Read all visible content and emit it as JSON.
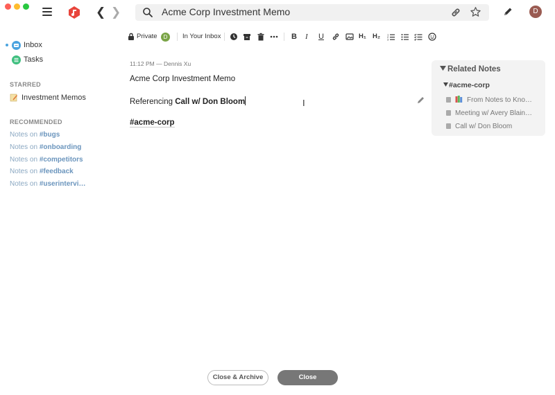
{
  "window": {
    "search_value": "Acme Corp Investment Memo",
    "user_initial": "D",
    "icons": [
      "menu-icon",
      "app-logo-icon",
      "back-icon",
      "forward-icon",
      "search-icon",
      "link-icon",
      "star-icon",
      "compose-icon"
    ]
  },
  "toolbar": {
    "privacy_label": "Private",
    "owner_initial": "D",
    "location_label": "In Your Inbox",
    "format_labels": {
      "bold": "B",
      "italic": "I",
      "underline": "U",
      "h1": "H₁",
      "h2": "H₂"
    }
  },
  "sidebar": {
    "items": [
      {
        "label": "Inbox",
        "icon": "inbox-icon",
        "color": "#4aa3df"
      },
      {
        "label": "Tasks",
        "icon": "tasks-icon",
        "color": "#3fbf7f"
      }
    ],
    "starred_heading": "STARRED",
    "starred": [
      {
        "label": "Investment Memos",
        "icon": "memo-icon"
      }
    ],
    "recommended_heading": "RECOMMENDED",
    "recommended_prefix": "Notes on",
    "recommended": [
      "#bugs",
      "#onboarding",
      "#competitors",
      "#feedback",
      "#userintervi…"
    ]
  },
  "note": {
    "meta": "11:12 PM — Dennis Xu",
    "title": "Acme Corp Investment Memo",
    "ref_prefix": "Referencing",
    "ref_link": "Call w/ Don Bloom",
    "tag": "#acme-corp"
  },
  "related": {
    "heading": "Related Notes",
    "tag": "#acme-corp",
    "items": [
      "From Notes to Kno…",
      "Meeting w/ Avery Blain…",
      "Call w/ Don Bloom"
    ]
  },
  "footer": {
    "archive_label": "Close & Archive",
    "close_label": "Close"
  }
}
